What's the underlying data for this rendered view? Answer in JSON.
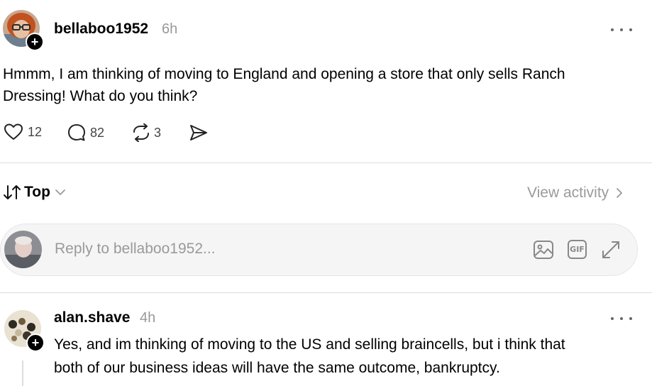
{
  "post": {
    "username": "bellaboo1952",
    "time": "6h",
    "text_line1": "Hmmm, I am thinking of moving to England and opening a store that only sells Ranch",
    "text_line2": "Dressing! What do you think?",
    "likes": "12",
    "comments": "82",
    "reposts": "3",
    "avatar_icon": "user-avatar-redhair-glasses",
    "follow_icon": "plus-icon"
  },
  "sort": {
    "label": "Top",
    "view_activity": "View activity"
  },
  "reply": {
    "placeholder": "Reply to bellaboo1952...",
    "gif_label": "GIF"
  },
  "comment": {
    "username": "alan.shave",
    "time": "4h",
    "text_line1": "Yes, and im thinking of moving to the US and selling braincells, but i think that",
    "text_line2": "both of our business ideas will have the same outcome, bankruptcy."
  },
  "colors": {
    "text": "#000000",
    "muted": "#999999",
    "divider": "#dddddd",
    "reply_bg": "#f5f5f5"
  }
}
